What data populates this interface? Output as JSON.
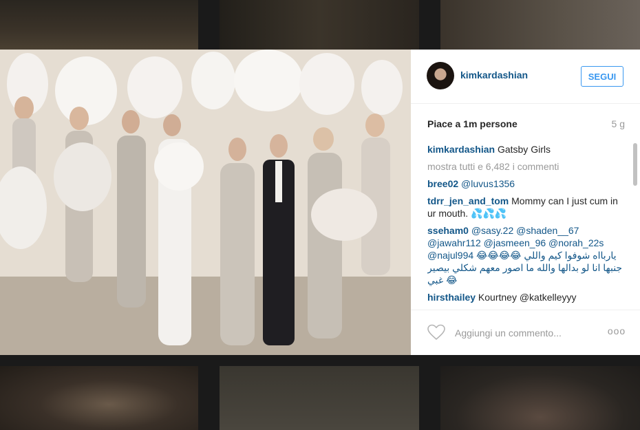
{
  "post": {
    "username": "kimkardashian",
    "follow_label": "SEGUI",
    "likes": "Piace a 1m persone",
    "time": "5 g"
  },
  "caption": {
    "user": "kimkardashian",
    "text": "Gatsby Girls"
  },
  "more_comments": "mostra tutti e 6,482 i commenti",
  "comments": [
    {
      "user": "bree02",
      "text": "@luvus1356"
    },
    {
      "user": "tdrr_jen_and_tom",
      "text": "Mommy can I just cum in ur mouth. 💦💦💦"
    },
    {
      "user": "sseham0",
      "text": "@sasy.22 @shaden__67 @jawahr112 @jasmeen_96 @norah_22s @najul994 😂😂😂😂 ياربااه شوفوا كيم واللي جنبها انا لو بدالها والله ما اصور معهم شكلي بيصير غبي 😂"
    },
    {
      "user": "hirsthailey",
      "text": "Kourtney @katkelleyyy"
    }
  ],
  "comment_placeholder": "Aggiungi un commento...",
  "more_options": "ooo",
  "icons": {
    "like": "heart-outline-icon",
    "options": "more-options-icon"
  },
  "colors": {
    "link": "#125688",
    "accent": "#3897f0",
    "muted": "#999999"
  }
}
